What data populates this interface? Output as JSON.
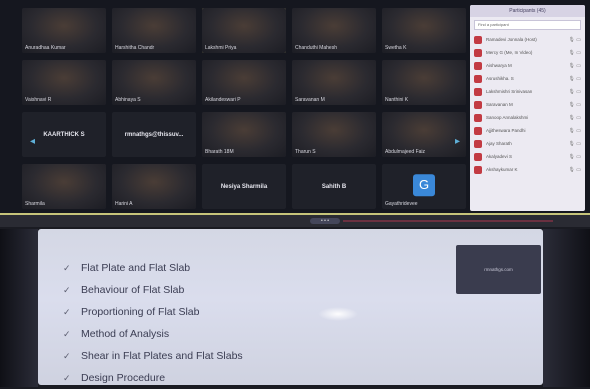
{
  "gallery": {
    "tiles": [
      {
        "name": "Anuradhaa Kumar",
        "type": "video"
      },
      {
        "name": "Harshitha Chandr",
        "type": "video"
      },
      {
        "name": "Lakshmi Priya",
        "type": "video",
        "active": true
      },
      {
        "name": "Chanduthi Mahesh",
        "type": "video"
      },
      {
        "name": "Swetha K",
        "type": "video"
      },
      {
        "name": "Vaishnavi R",
        "type": "video"
      },
      {
        "name": "Abhinaya S",
        "type": "video"
      },
      {
        "name": "Akilandeswari P",
        "type": "video"
      },
      {
        "name": "Saravanan M",
        "type": "video"
      },
      {
        "name": "Nanthini K",
        "type": "video"
      },
      {
        "name": "KAARTHICK S",
        "type": "text"
      },
      {
        "name": "rmnathgs@thissuv...",
        "type": "text"
      },
      {
        "name": "Bharath 18M",
        "type": "video"
      },
      {
        "name": "Tharun S",
        "type": "video"
      },
      {
        "name": "Abdulmajeed Faiz",
        "type": "video"
      },
      {
        "name": "Sharmila",
        "type": "video"
      },
      {
        "name": "Harini A",
        "type": "video"
      },
      {
        "name": "Nesiya Sharmila",
        "type": "text"
      },
      {
        "name": "Sahith B",
        "type": "text"
      },
      {
        "name": "Gayathridevee",
        "type": "avatar",
        "initial": "G"
      }
    ],
    "nav_left": "◂",
    "nav_right": "▸"
  },
  "participants": {
    "header": "Participants (45)",
    "search_placeholder": "Find a participant",
    "rows": [
      {
        "name": "Ramadevi Jonnala (Host)",
        "icons": "🎙 ▭"
      },
      {
        "name": "Mercy G  (Me, In Video)",
        "icons": "🎙 ▭"
      },
      {
        "name": "Aishwarya M",
        "icons": "🎙 ▭"
      },
      {
        "name": "Asrushikha. S",
        "icons": "🎙 ▭"
      },
      {
        "name": "Lakshmishri Srinivasan",
        "icons": "🎙 ▭"
      },
      {
        "name": "Saravanan M",
        "icons": "🎙 ▭"
      },
      {
        "name": "Sanoop Annalakshmi",
        "icons": "🎙 ▭"
      },
      {
        "name": "Ajjitheswara Pandhi",
        "icons": "🎙 ▭"
      },
      {
        "name": "Ajay Sharath",
        "icons": "🎙 ▭"
      },
      {
        "name": "Akalyadevi S",
        "icons": "🎙 ▭"
      },
      {
        "name": "Akshaykumar K",
        "icons": "🎙 ▭"
      }
    ],
    "avatar_color": "#c23a42"
  },
  "share_bar": {
    "pill_label": "• • •"
  },
  "slide": {
    "bullets": [
      "Flat Plate and Flat Slab",
      "Behaviour of Flat Slab",
      "Proportioning of Flat Slab",
      "Method of Analysis",
      "Shear in Flat Plates and Flat Slabs",
      "Design Procedure"
    ],
    "tick_symbol": "✓",
    "self_view_name": "rmnathgs.com"
  }
}
